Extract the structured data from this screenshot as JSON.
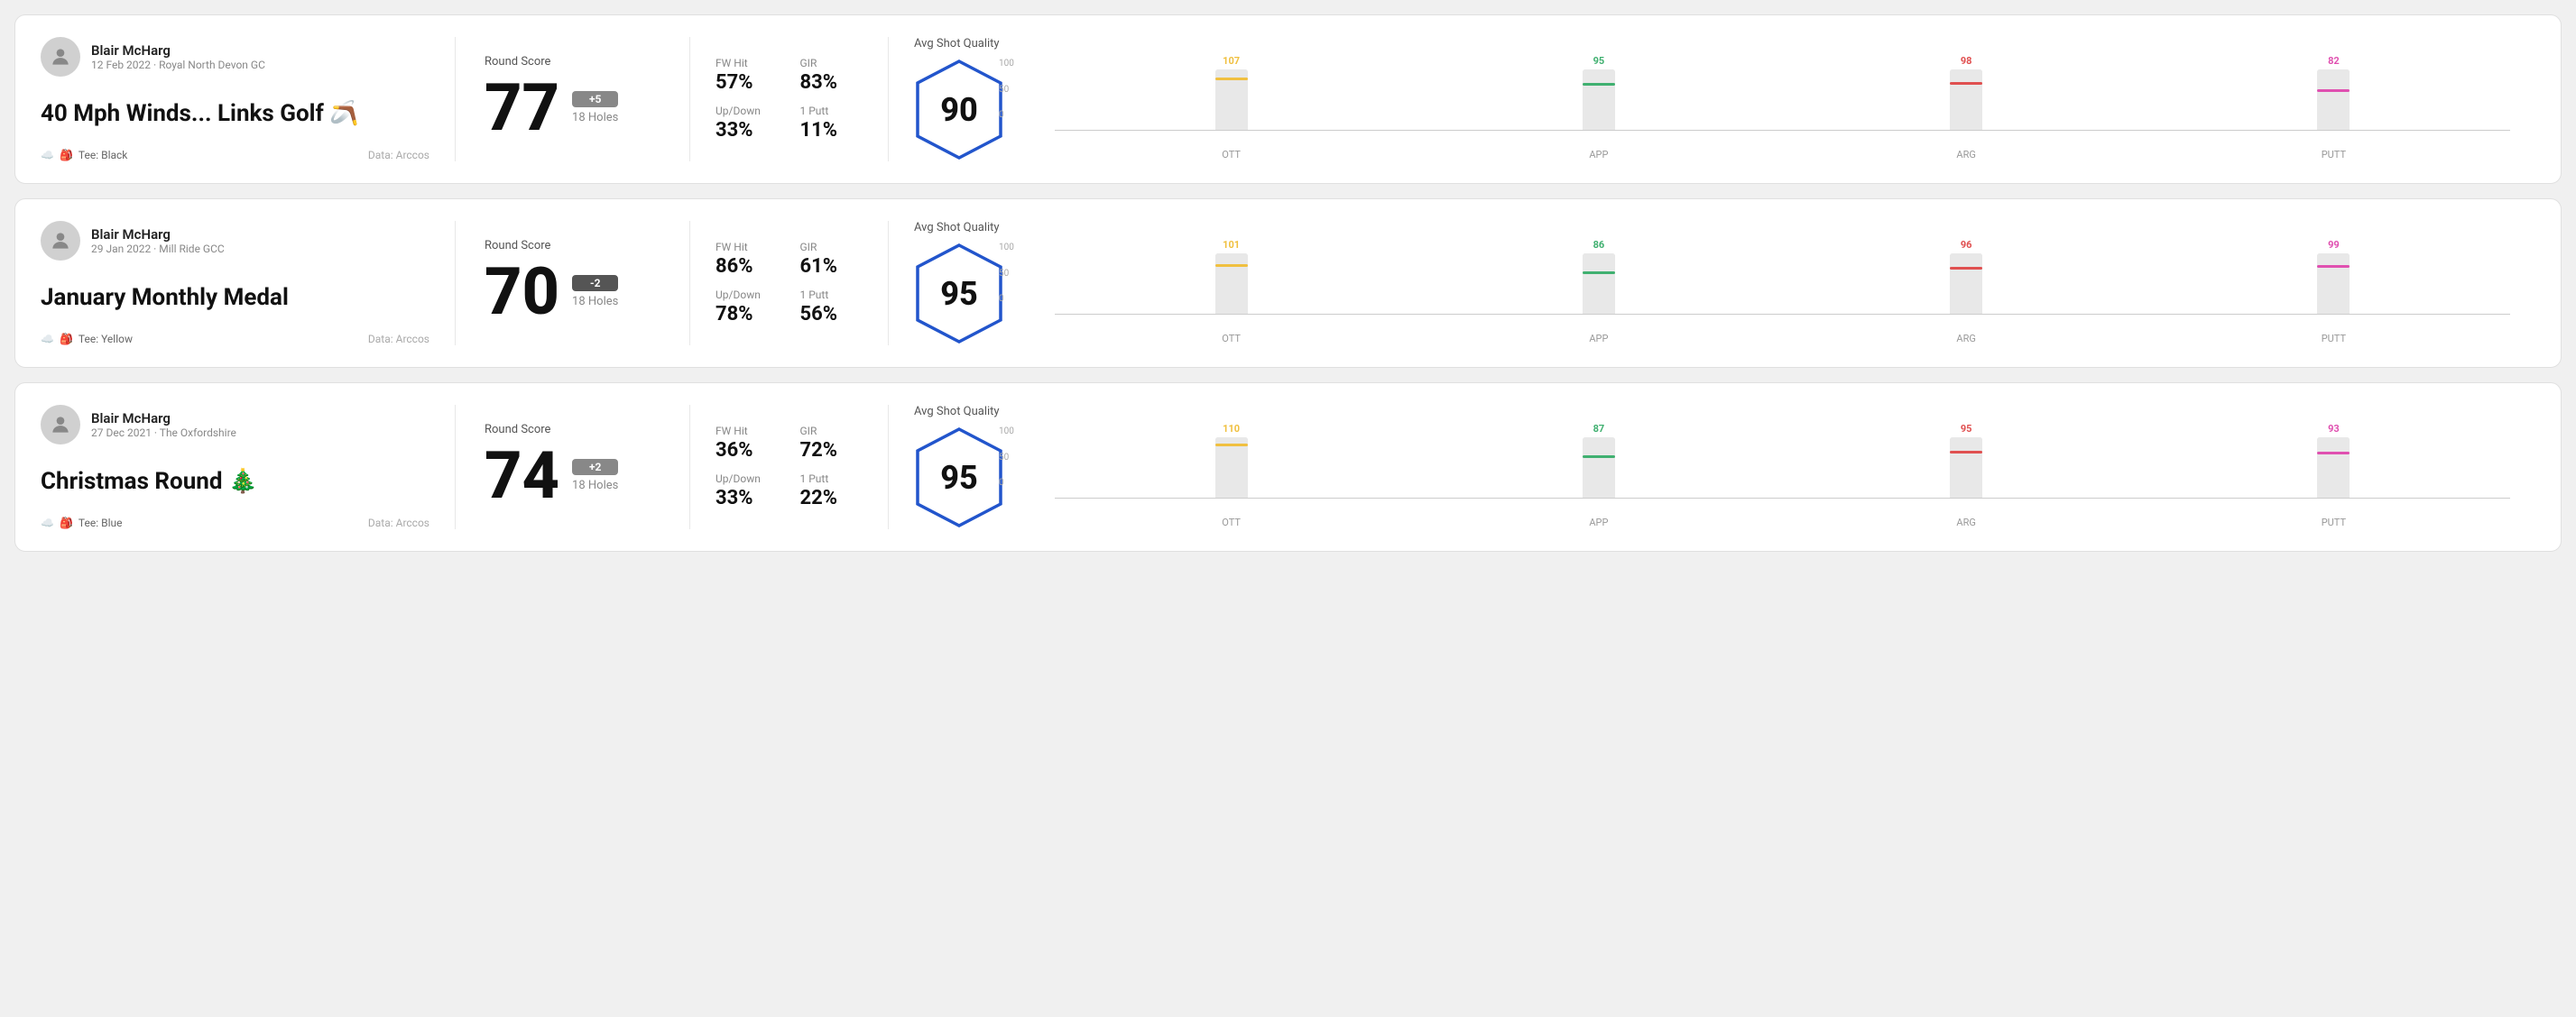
{
  "rounds": [
    {
      "id": "round1",
      "player_name": "Blair McHarg",
      "date": "12 Feb 2022 · Royal North Devon GC",
      "title": "40 Mph Winds... Links Golf",
      "title_emoji": "🪃",
      "tee": "Tee: Black",
      "data_source": "Data: Arccos",
      "score": "77",
      "score_diff": "+5",
      "score_diff_type": "over",
      "holes": "18 Holes",
      "fw_hit_label": "FW Hit",
      "fw_hit_value": "57%",
      "gir_label": "GIR",
      "gir_value": "83%",
      "updown_label": "Up/Down",
      "updown_value": "33%",
      "oneputt_label": "1 Putt",
      "oneputt_value": "11%",
      "avg_shot_quality_label": "Avg Shot Quality",
      "quality_score": "90",
      "chart": {
        "bars": [
          {
            "label": "OTT",
            "value": 107,
            "color": "#f0c040",
            "max": 130
          },
          {
            "label": "APP",
            "value": 95,
            "color": "#40b070",
            "max": 130
          },
          {
            "label": "ARG",
            "value": 98,
            "color": "#e05050",
            "max": 130
          },
          {
            "label": "PUTT",
            "value": 82,
            "color": "#e050b0",
            "max": 130
          }
        ],
        "y_labels": [
          "100",
          "50",
          "0"
        ]
      }
    },
    {
      "id": "round2",
      "player_name": "Blair McHarg",
      "date": "29 Jan 2022 · Mill Ride GCC",
      "title": "January Monthly Medal",
      "title_emoji": "",
      "tee": "Tee: Yellow",
      "data_source": "Data: Arccos",
      "score": "70",
      "score_diff": "-2",
      "score_diff_type": "under",
      "holes": "18 Holes",
      "fw_hit_label": "FW Hit",
      "fw_hit_value": "86%",
      "gir_label": "GIR",
      "gir_value": "61%",
      "updown_label": "Up/Down",
      "updown_value": "78%",
      "oneputt_label": "1 Putt",
      "oneputt_value": "56%",
      "avg_shot_quality_label": "Avg Shot Quality",
      "quality_score": "95",
      "chart": {
        "bars": [
          {
            "label": "OTT",
            "value": 101,
            "color": "#f0c040",
            "max": 130
          },
          {
            "label": "APP",
            "value": 86,
            "color": "#40b070",
            "max": 130
          },
          {
            "label": "ARG",
            "value": 96,
            "color": "#e05050",
            "max": 130
          },
          {
            "label": "PUTT",
            "value": 99,
            "color": "#e050b0",
            "max": 130
          }
        ],
        "y_labels": [
          "100",
          "50",
          "0"
        ]
      }
    },
    {
      "id": "round3",
      "player_name": "Blair McHarg",
      "date": "27 Dec 2021 · The Oxfordshire",
      "title": "Christmas Round",
      "title_emoji": "🎄",
      "tee": "Tee: Blue",
      "data_source": "Data: Arccos",
      "score": "74",
      "score_diff": "+2",
      "score_diff_type": "over",
      "holes": "18 Holes",
      "fw_hit_label": "FW Hit",
      "fw_hit_value": "36%",
      "gir_label": "GIR",
      "gir_value": "72%",
      "updown_label": "Up/Down",
      "updown_value": "33%",
      "oneputt_label": "1 Putt",
      "oneputt_value": "22%",
      "avg_shot_quality_label": "Avg Shot Quality",
      "quality_score": "95",
      "chart": {
        "bars": [
          {
            "label": "OTT",
            "value": 110,
            "color": "#f0c040",
            "max": 130
          },
          {
            "label": "APP",
            "value": 87,
            "color": "#40b070",
            "max": 130
          },
          {
            "label": "ARG",
            "value": 95,
            "color": "#e05050",
            "max": 130
          },
          {
            "label": "PUTT",
            "value": 93,
            "color": "#e050b0",
            "max": 130
          }
        ],
        "y_labels": [
          "100",
          "50",
          "0"
        ]
      }
    }
  ]
}
